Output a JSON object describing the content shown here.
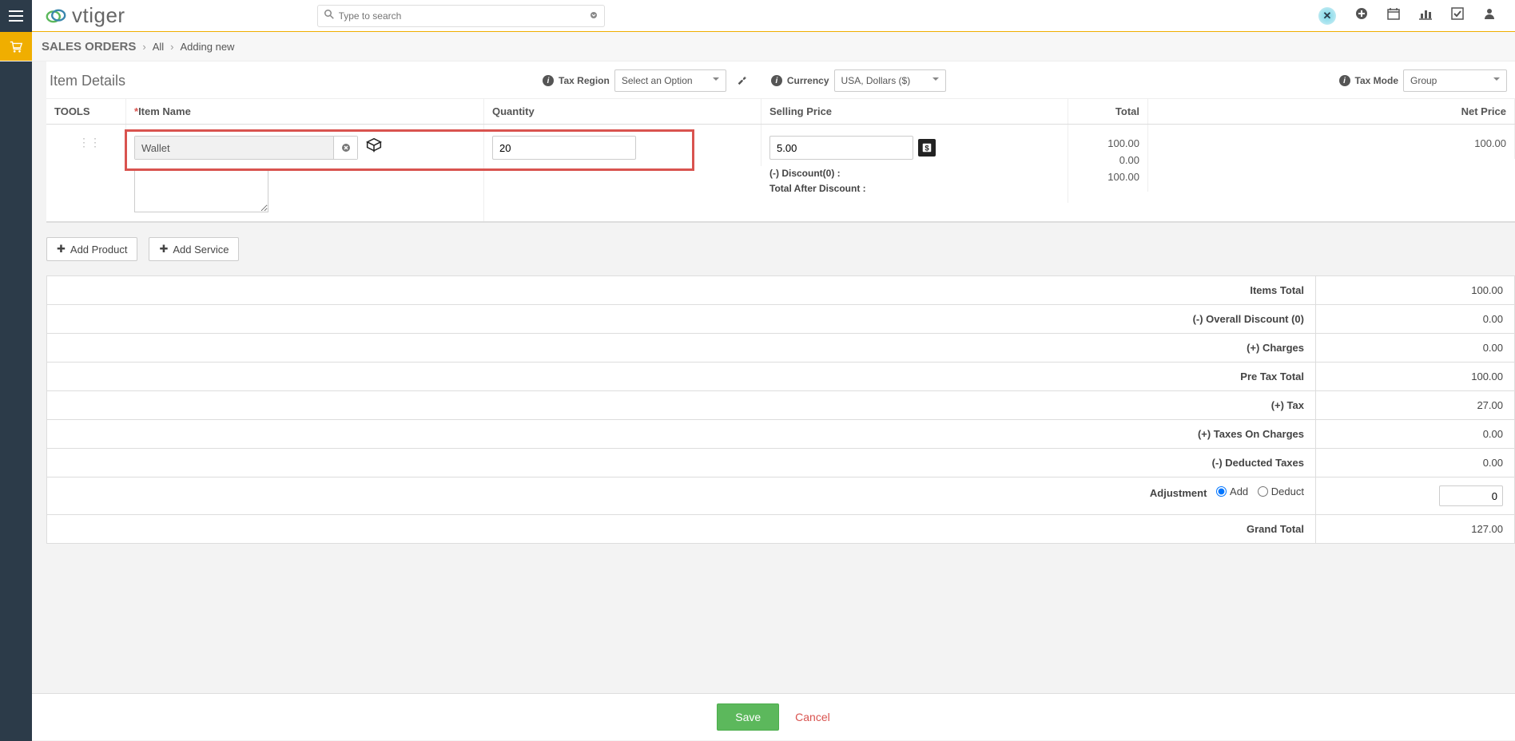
{
  "header": {
    "brand": "vtiger",
    "search_placeholder": "Type to search"
  },
  "breadcrumb": {
    "module": "SALES ORDERS",
    "all": "All",
    "current": "Adding new"
  },
  "item_details": {
    "title": "Item Details",
    "tax_region": {
      "label": "Tax Region",
      "selected": "Select an Option"
    },
    "currency": {
      "label": "Currency",
      "selected": "USA, Dollars ($)"
    },
    "tax_mode": {
      "label": "Tax Mode",
      "selected": "Group"
    },
    "columns": {
      "tools": "TOOLS",
      "item_name": "Item Name",
      "quantity": "Quantity",
      "selling_price": "Selling Price",
      "total": "Total",
      "net_price": "Net Price"
    },
    "row": {
      "product_name": "Wallet",
      "quantity": "20",
      "price": "5.00",
      "discount_label": "(-) Discount(0) :",
      "after_discount_label": "Total After Discount :",
      "total": "100.00",
      "discount_total": "0.00",
      "after_discount_total": "100.00",
      "net_price": "100.00"
    }
  },
  "actions": {
    "add_product": "Add Product",
    "add_service": "Add Service"
  },
  "summary": {
    "items_total": {
      "label": "Items Total",
      "value": "100.00"
    },
    "overall_discount": {
      "label": "(-) Overall Discount (0)",
      "value": "0.00"
    },
    "charges": {
      "label": "(+) Charges",
      "value": "0.00"
    },
    "pre_tax_total": {
      "label": "Pre Tax Total",
      "value": "100.00"
    },
    "tax": {
      "label": "(+) Tax",
      "value": "27.00"
    },
    "taxes_on_charges": {
      "label": "(+) Taxes On Charges",
      "value": "0.00"
    },
    "deducted_taxes": {
      "label": "(-) Deducted Taxes",
      "value": "0.00"
    },
    "adjustment": {
      "label": "Adjustment",
      "add": "Add",
      "deduct": "Deduct",
      "value": "0"
    },
    "grand_total": {
      "label": "Grand Total",
      "value": "127.00"
    }
  },
  "footer": {
    "save": "Save",
    "cancel": "Cancel"
  }
}
